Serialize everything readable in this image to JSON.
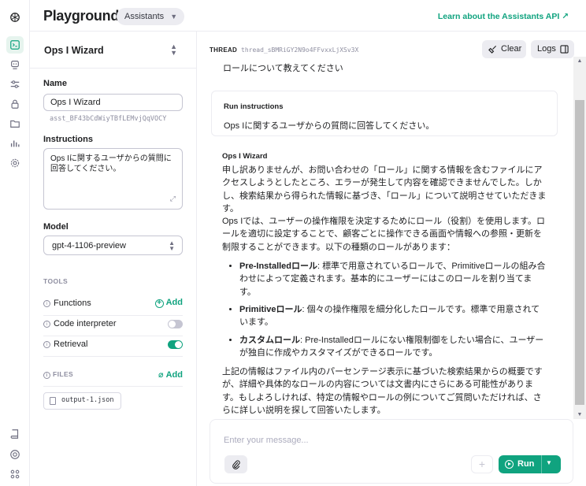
{
  "app": {
    "title": "Playground",
    "mode": "Assistants",
    "learn_link": "Learn about the Assistants API ↗"
  },
  "sidebar_icons": [
    "openai-logo-icon",
    "playground-icon",
    "assistants-icon",
    "tune-icon",
    "lock-icon",
    "files-icon",
    "usage-icon",
    "settings-icon",
    "docs-icon",
    "help-icon",
    "apps-icon"
  ],
  "assistant": {
    "selected_name": "Ops I Wizard",
    "name_label": "Name",
    "name_value": "Ops I Wizard",
    "id": "asst_BF43bCdWiyTBfLEMvjQqVOCY",
    "instructions_label": "Instructions",
    "instructions_value": "Ops Iに関するユーザからの質問に回答してください。",
    "model_label": "Model",
    "model_value": "gpt-4-1106-preview",
    "tools_header": "TOOLS",
    "tools": [
      {
        "name": "Functions",
        "action": "Add"
      },
      {
        "name": "Code interpreter",
        "enabled": false
      },
      {
        "name": "Retrieval",
        "enabled": true
      }
    ],
    "files_header": "FILES",
    "files_add": "Add",
    "file_name": "output-1.json"
  },
  "thread": {
    "label": "THREAD",
    "id": "thread_sBMRiGY2N9o4FFvxxLjXSv3X",
    "clear_label": "Clear",
    "logs_label": "Logs",
    "prev_user_msg": "ロールについて教えてください",
    "run_card": {
      "title": "Run instructions",
      "body": "Ops Iに関するユーザからの質問に回答してください。"
    },
    "reply": {
      "author": "Ops I Wizard",
      "para1": "申し訳ありませんが、お問い合わせの「ロール」に関する情報を含むファイルにアクセスしようとしたところ、エラーが発生して内容を確認できませんでした。しかし、検索結果から得られた情報に基づき、「ロール」について説明させていただきます。",
      "para2": "Ops Iでは、ユーザーの操作権限を決定するためにロール（役割）を使用します。ロールを適切に設定することで、顧客ごとに操作できる画面や情報への参照・更新を制限することができます。以下の種類のロールがあります：",
      "items": [
        {
          "term": "Pre-Installedロール",
          "desc": ": 標準で用意されているロールで、Primitiveロールの組み合わせによって定義されます。基本的にユーザーにはこのロールを割り当てます。"
        },
        {
          "term": "Primitiveロール",
          "desc": ": 個々の操作権限を細分化したロールです。標準で用意されています。"
        },
        {
          "term": "カスタムロール",
          "desc": ": Pre-Installedロールにない権限制御をしたい場合に、ユーザーが独自に作成やカスタマイズができるロールです。"
        }
      ],
      "para3": "上記の情報はファイル内のパーセンテージ表示に基づいた検索結果からの概要ですが、詳細や具体的なロールの内容については文書内にさらにある可能性があります。もしよろしければ、特定の情報やロールの例についてご質問いただければ、さらに詳しい説明を探して回答いたします。"
    }
  },
  "composer": {
    "placeholder": "Enter your message...",
    "run_label": "Run",
    "add_symbol": "+"
  },
  "colors": {
    "accent": "#10a37f",
    "border": "#ececf1",
    "muted_text": "#8e8ea0"
  }
}
